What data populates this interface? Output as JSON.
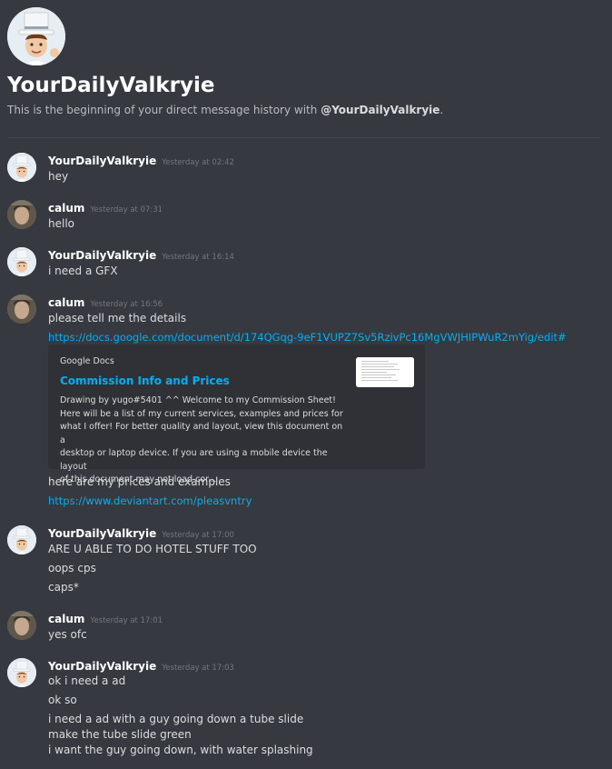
{
  "header": {
    "title": "YourDailyValkryie",
    "subtitle_prefix": "This is the beginning of your direct message history with",
    "subtitle_user": "@YourDailyValkryie",
    "subtitle_suffix": "."
  },
  "messages": [
    {
      "author": "YourDailyValkryie",
      "timestamp": "Yesterday at 02:42",
      "lines": [
        "hey"
      ]
    },
    {
      "author": "calum",
      "timestamp": "Yesterday at 07:31",
      "lines": [
        "hello"
      ]
    },
    {
      "author": "YourDailyValkryie",
      "timestamp": "Yesterday at 16:14",
      "lines": [
        "i need a GFX"
      ]
    },
    {
      "author": "calum",
      "timestamp": "Yesterday at 16:56",
      "lines": [
        "please tell me the details",
        "https://docs.google.com/document/d/174QGqg-9eF1VUPZ7Sv5RzivPc16MgVWJHIPWuR2mYig/edit#"
      ],
      "after_embed": [
        "here are my prices and examples",
        "https://www.deviantart.com/pleasvntry"
      ]
    },
    {
      "author": "YourDailyValkryie",
      "timestamp": "Yesterday at 17:00",
      "lines": [
        "ARE U ABLE TO DO HOTEL STUFF TOO",
        "oops cps",
        "caps*"
      ]
    },
    {
      "author": "calum",
      "timestamp": "Yesterday at 17:01",
      "lines": [
        "yes ofc"
      ]
    },
    {
      "author": "YourDailyValkryie",
      "timestamp": "Yesterday at 17:03",
      "lines": [
        "ok i need a ad",
        "ok so",
        "i need a ad with a guy going down a tube slide",
        "make the tube slide  green",
        "i want the guy going down, with water splashing"
      ]
    }
  ],
  "embed": {
    "provider": "Google Docs",
    "title": "Commission Info and Prices",
    "description": [
      "Drawing by yugo#5401 ^^ Welcome to my Commission Sheet!",
      "Here will be a list of my current services, examples and prices for",
      "what I offer! For better quality and layout, view this document on a",
      "desktop or laptop device. If you are using a mobile device the layout",
      "of this document may not load cor..."
    ]
  },
  "colors": {
    "background": "#36393f",
    "embed_background": "#2f3136",
    "link": "#00b0f4",
    "username": "#ffffff",
    "timestamp": "#72767d"
  },
  "icons": {
    "valkryie_avatar": "bitmoji-top-hat-avatar",
    "calum_avatar": "photo-avatar"
  }
}
